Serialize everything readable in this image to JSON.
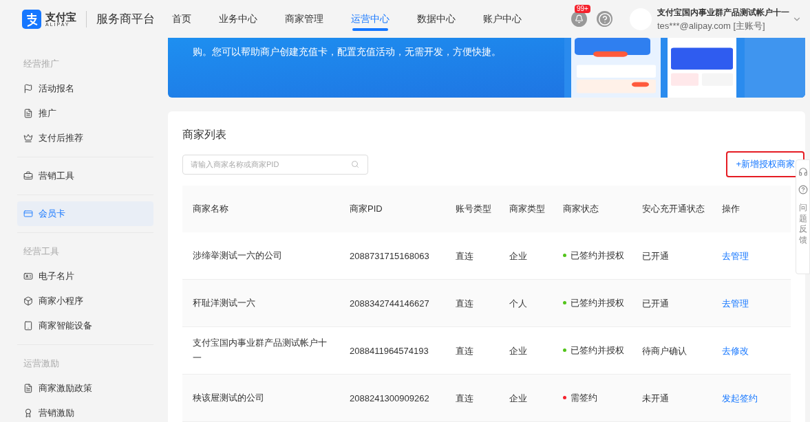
{
  "header": {
    "logo_text": "支付宝",
    "logo_sub": "ALIPAY",
    "platform": "服务商平台",
    "nav": [
      {
        "label": "首页",
        "selected": false
      },
      {
        "label": "业务中心",
        "selected": false
      },
      {
        "label": "商家管理",
        "selected": false
      },
      {
        "label": "运营中心",
        "selected": true
      },
      {
        "label": "数据中心",
        "selected": false
      },
      {
        "label": "账户中心",
        "selected": false
      }
    ],
    "badge": "99+",
    "account_name": "支付宝国内事业群产品测试帐户十一",
    "account_email": "tes***@alipay.com [主账号]"
  },
  "sidebar": {
    "groups": [
      {
        "title": "经营推广",
        "items": [
          {
            "label": "活动报名",
            "selected": false
          },
          {
            "label": "推广",
            "selected": false
          },
          {
            "label": "支付后推荐",
            "selected": false
          }
        ]
      },
      {
        "items": [
          {
            "label": "营销工具",
            "selected": false
          }
        ]
      },
      {
        "items": [
          {
            "label": "会员卡",
            "selected": true
          }
        ]
      },
      {
        "title": "经营工具",
        "items": [
          {
            "label": "电子名片",
            "selected": false
          },
          {
            "label": "商家小程序",
            "selected": false
          },
          {
            "label": "商家智能设备",
            "selected": false
          }
        ]
      },
      {
        "title": "运营激励",
        "items": [
          {
            "label": "商家激励政策",
            "selected": false
          },
          {
            "label": "营销激励",
            "selected": false
          }
        ]
      }
    ]
  },
  "banner": {
    "text": "购。您可以帮助商户创建充值卡，配置充值活动，无需开发，方便快捷。"
  },
  "merchant_list": {
    "title": "商家列表",
    "search": {
      "placeholder": "请输入商家名称或商家PID"
    },
    "add_button": "+新增授权商家",
    "columns": [
      "商家名称",
      "商家PID",
      "账号类型",
      "商家类型",
      "商家状态",
      "安心充开通状态",
      "操作"
    ],
    "rows": [
      {
        "name": "涉缔举测试一六的公司",
        "pid": "2088731715168063",
        "account_type": "直连",
        "merchant_type": "企业",
        "status": "已签约并授权",
        "color": "#52c41a",
        "anxin": "已开通",
        "action": "去管理"
      },
      {
        "name": "秆耻洋测试一六",
        "pid": "2088342744146627",
        "account_type": "直连",
        "merchant_type": "个人",
        "status": "已签约并授权",
        "color": "#52c41a",
        "anxin": "已开通",
        "action": "去管理"
      },
      {
        "name": "支付宝国内事业群产品测试帐户十一",
        "pid": "2088411964574193",
        "account_type": "直连",
        "merchant_type": "企业",
        "status": "已签约并授权",
        "color": "#52c41a",
        "anxin": "待商户确认",
        "action": "去修改"
      },
      {
        "name": "秧该屉测试的公司",
        "pid": "2088241300909262",
        "account_type": "直连",
        "merchant_type": "企业",
        "status": "需签约",
        "color": "#f5222d",
        "anxin": "未开通",
        "action": "发起签约"
      }
    ]
  },
  "floating_panel": {
    "feedback": "问题反馈"
  }
}
